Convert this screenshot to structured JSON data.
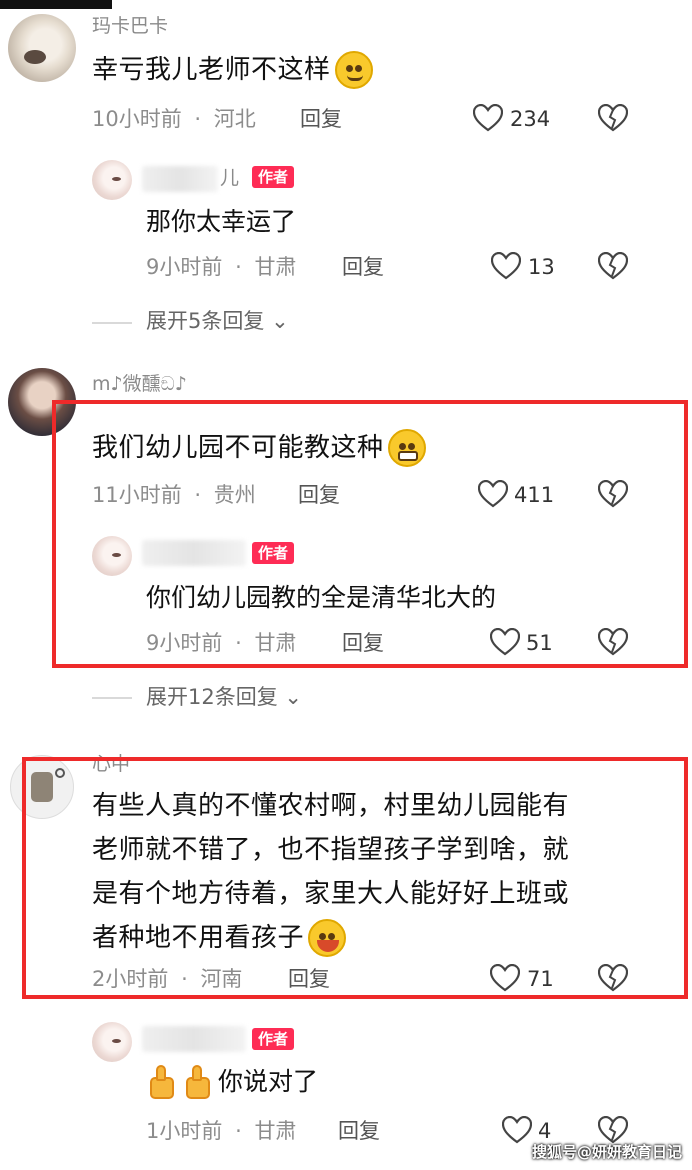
{
  "threads": [
    {
      "username": "玛卡巴卡",
      "text": "幸亏我儿老师不这样",
      "time": "10小时前",
      "location": "河北",
      "reply_label": "回复",
      "likes": "234",
      "emoji": "smile",
      "author_reply": {
        "name_suffix": "儿",
        "badge": "作者",
        "text": "那你太幸运了",
        "time": "9小时前",
        "location": "甘肃",
        "reply_label": "回复",
        "likes": "13"
      },
      "expand_label": "展开5条回复"
    },
    {
      "username": "m♪微醺ඞ♪",
      "text": "我们幼儿园不可能教这种",
      "time": "11小时前",
      "location": "贵州",
      "reply_label": "回复",
      "likes": "411",
      "emoji": "grin",
      "author_reply": {
        "badge": "作者",
        "text": "你们幼儿园教的全是清华北大的",
        "time": "9小时前",
        "location": "甘肃",
        "reply_label": "回复",
        "likes": "51"
      },
      "expand_label": "展开12条回复"
    },
    {
      "username": "心中",
      "text_lines": [
        "有些人真的不懂农村啊，村里幼儿园能有",
        "老师就不错了，也不指望孩子学到啥，就",
        "是有个地方待着，家里大人能好好上班或",
        "者种地不用看孩子"
      ],
      "time": "2小时前",
      "location": "河南",
      "reply_label": "回复",
      "likes": "71",
      "emoji": "laugh",
      "author_reply": {
        "badge": "作者",
        "text": "你说对了",
        "time": "1小时前",
        "location": "甘肃",
        "reply_label": "回复",
        "likes": "4"
      }
    }
  ],
  "meta_separator": "·",
  "expand_chevron": "⌄",
  "watermark": "搜狐号@妍妍教育日记",
  "colors": {
    "highlight_box": "#ee2a2a",
    "author_badge": "#fe2c55"
  },
  "icons": [
    "heart-icon",
    "dislike-icon",
    "chevron-down-icon",
    "thumbs-up-icon"
  ]
}
